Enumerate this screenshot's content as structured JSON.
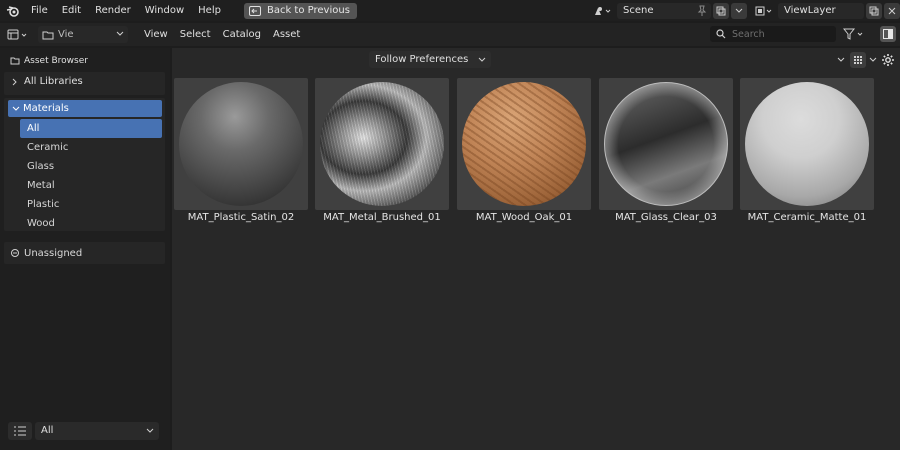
{
  "topbar": {
    "menus": [
      "File",
      "Edit",
      "Render",
      "Window",
      "Help"
    ],
    "back_button": "Back to Previous",
    "scene": "Scene",
    "view_layer": "ViewLayer"
  },
  "header": {
    "editor_view_label": "Vie",
    "menus": [
      "View",
      "Select",
      "Catalog",
      "Asset"
    ],
    "search_placeholder": "Search"
  },
  "sidebar": {
    "title": "Asset Browser",
    "all_libraries": "All Libraries",
    "catalog_root": "Materials",
    "catalogs": [
      "All",
      "Ceramic",
      "Glass",
      "Metal",
      "Plastic",
      "Wood"
    ],
    "active_catalog": "All",
    "unassigned": "Unassigned",
    "import_method": "All"
  },
  "main": {
    "import_dropdown": "Follow Preferences",
    "assets": [
      {
        "name": "MAT_Plastic_Satin_02",
        "preview": "plastic-sphere"
      },
      {
        "name": "MAT_Metal_Brushed_01",
        "preview": "metal-sphere"
      },
      {
        "name": "MAT_Wood_Oak_01",
        "preview": "wood-sphere"
      },
      {
        "name": "MAT_Glass_Clear_03",
        "preview": "glass-sphere"
      },
      {
        "name": "MAT_Ceramic_Matte_01",
        "preview": "ceramic-sphere"
      }
    ]
  },
  "colors": {
    "accent": "#4772b3",
    "panel": "#262626",
    "background": "#1d1d1d",
    "main": "#282828"
  }
}
